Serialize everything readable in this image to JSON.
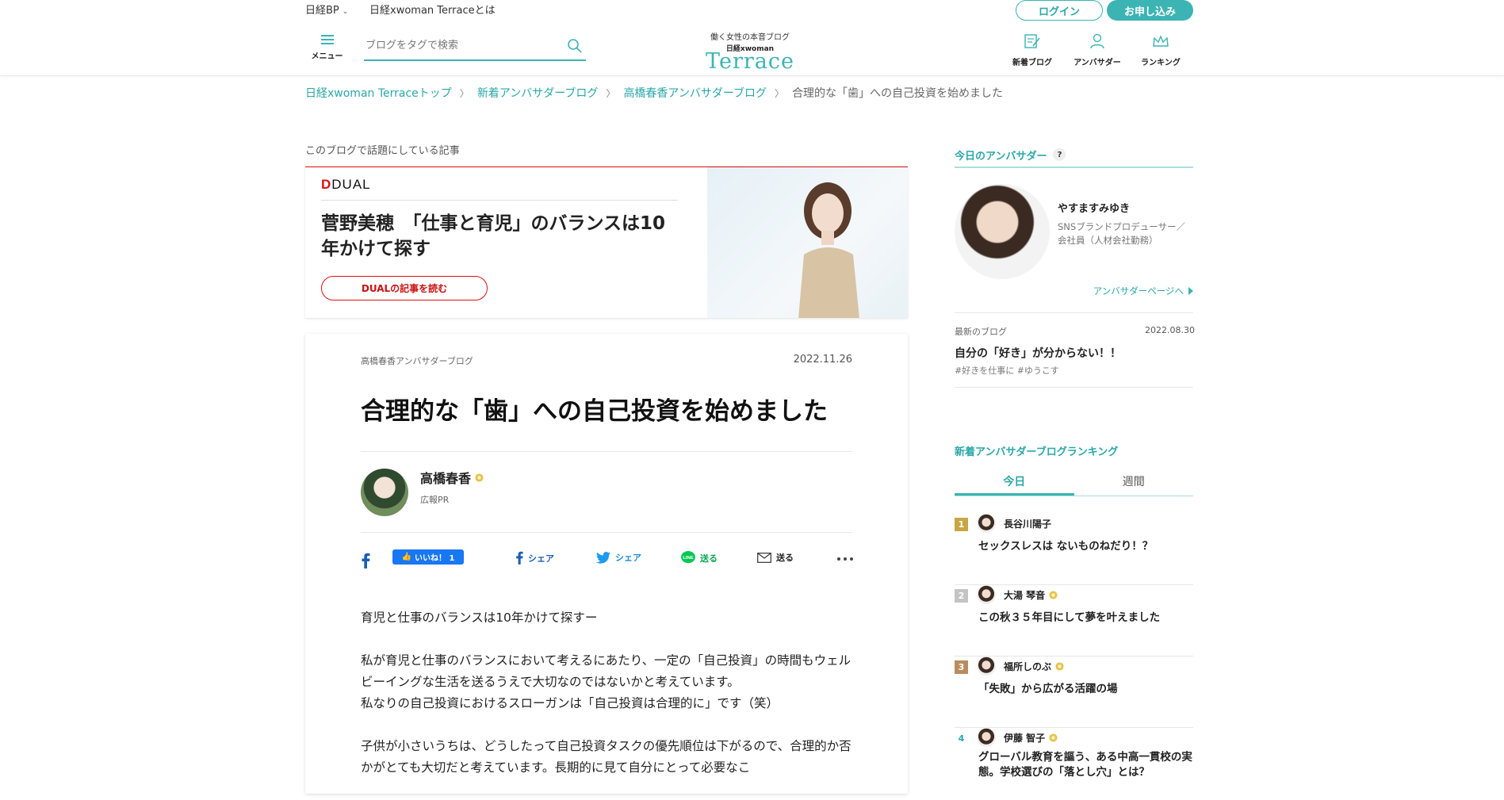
{
  "header": {
    "util_links": [
      "日経BP",
      "日経xwoman Terraceとは"
    ],
    "login": "ログイン",
    "signup": "お申し込み",
    "menu_label": "メニュー",
    "search_placeholder": "ブログをタグで検索",
    "logo_tagline": "働く女性の本音ブログ",
    "logo_brand": "日経xwoman",
    "logo_name": "Terrace",
    "nav": [
      {
        "label": "新着ブログ",
        "icon": "new-blog-icon"
      },
      {
        "label": "アンバサダー",
        "icon": "ambassador-icon"
      },
      {
        "label": "ランキング",
        "icon": "ranking-crown-icon"
      }
    ]
  },
  "breadcrumb": [
    "日経xwoman Terraceトップ",
    "新着アンバサダーブログ",
    "高橋春香アンバサダーブログ",
    "合理的な「歯」への自己投資を始めました"
  ],
  "featured": {
    "heading": "このブログで話題にしている記事",
    "source": "DUAL",
    "title": "菅野美穂　「仕事と育児」のバランスは10年かけて探す",
    "button": "DUALの記事を読む"
  },
  "article": {
    "blog_name": "高橋春香アンバサダーブログ",
    "date": "2022.11.26",
    "title": "合理的な「歯」への自己投資を始めました",
    "author": "高橋春香",
    "author_role": "広報PR",
    "like_label": "いいね！ 1",
    "share": {
      "fb": "シェア",
      "tw": "シェア",
      "line": "送る",
      "mail": "送る"
    },
    "paragraphs": [
      "育児と仕事のバランスは10年かけて探すー",
      "私が育児と仕事のバランスにおいて考えるにあたり、一定の「自己投資」の時間もウェルビーイングな生活を送るうえで大切なのではないかと考えています。\n私なりの自己投資におけるスローガンは「自己投資は合理的に」です（笑）",
      "子供が小さいうちは、どうしたって自己投資タスクの優先順位は下がるので、合理的か否かがとても大切だと考えています。長期的に見て自分にとって必要なこ"
    ]
  },
  "sidebar": {
    "today_title": "今日のアンバサダー",
    "today_help": "?",
    "ambassador_name": "やすますみゆき",
    "ambassador_role": "SNSブランドプロデューサー／会社員（人材会社勤務）",
    "ambassador_link": "アンバサダーページへ",
    "latest_label": "最新のブログ",
    "latest_date": "2022.08.30",
    "latest_title": "自分の「好き」が分からない！！",
    "latest_tags": "#好きを仕事に  #ゆうこす",
    "ranking_title": "新着アンバサダーブログランキング",
    "tabs": [
      "今日",
      "週間"
    ],
    "ranking": [
      {
        "rank": "1",
        "name": "長谷川陽子",
        "title": "セックスレスは ないものねだり！？",
        "badge": false,
        "color": "#c9a544"
      },
      {
        "rank": "2",
        "name": "大湯 琴音",
        "title": "この秋３５年目にして夢を叶えました",
        "badge": true,
        "color": "#c4c4c4"
      },
      {
        "rank": "3",
        "name": "福所しのぶ",
        "title": "「失敗」から広がる活躍の場",
        "badge": true,
        "color": "#b98c5f"
      },
      {
        "rank": "4",
        "name": "伊藤 智子",
        "title": "グローバル教育を謳う、ある中高一貫校の実態。学校選びの「落とし穴」とは？",
        "badge": true,
        "color": "#2aa7a7"
      }
    ]
  }
}
